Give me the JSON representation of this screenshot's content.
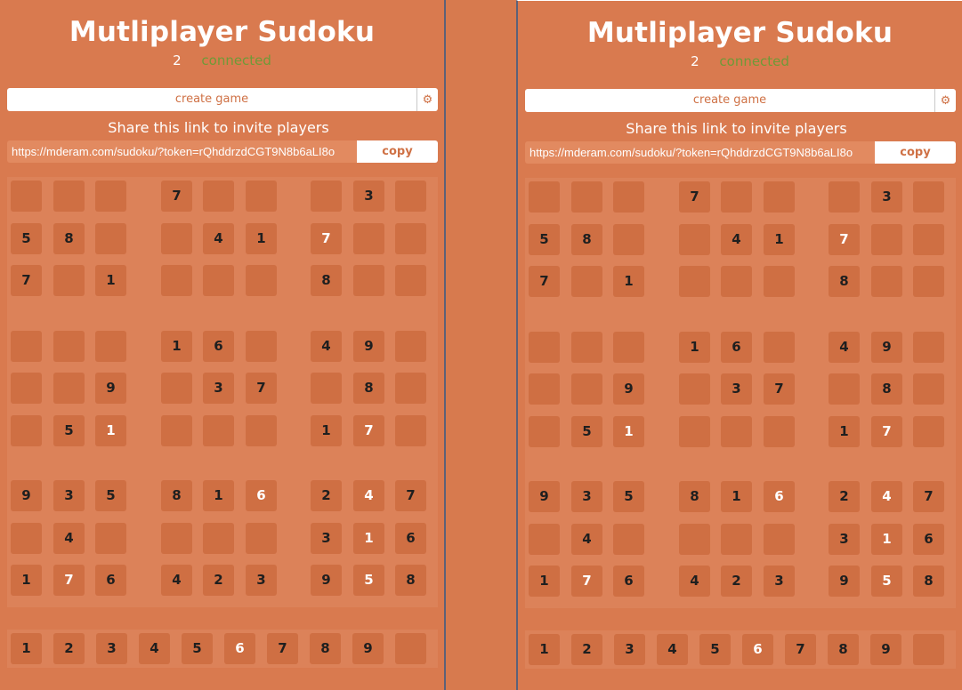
{
  "app": {
    "title": "Mutliplayer Sudoku",
    "connected_count": "2",
    "connected_label": "connected",
    "create_game_label": "create game",
    "settings_icon": "gear-icon",
    "share_label": "Share this link to invite players",
    "share_link": "https://mderam.com/sudoku/?token=rQhddrzdCGT9N8b6aLI8o",
    "copy_label": "copy"
  },
  "colors": {
    "background": "#d97a4f",
    "cell": "#cf6f43",
    "connected": "#6f9a38",
    "divider": "#5c6178"
  },
  "board": [
    [
      "",
      "",
      "",
      "7",
      "",
      "",
      "",
      "3",
      ""
    ],
    [
      "5",
      "8",
      "",
      "",
      "4",
      "1",
      "7",
      "",
      ""
    ],
    [
      "7",
      "",
      "1",
      "",
      "",
      "",
      "8",
      "",
      ""
    ],
    [
      "",
      "",
      "",
      "1",
      "6",
      "",
      "4",
      "9",
      ""
    ],
    [
      "",
      "",
      "9",
      "",
      "3",
      "7",
      "",
      "8",
      ""
    ],
    [
      "",
      "5",
      "1",
      "",
      "",
      "",
      "1",
      "7",
      ""
    ],
    [
      "9",
      "3",
      "5",
      "8",
      "1",
      "6",
      "2",
      "4",
      "7"
    ],
    [
      "",
      "4",
      "",
      "",
      "",
      "",
      "3",
      "1",
      "6"
    ],
    [
      "1",
      "7",
      "6",
      "4",
      "2",
      "3",
      "9",
      "5",
      "8"
    ]
  ],
  "white_cells": [
    [
      1,
      6
    ],
    [
      5,
      2
    ],
    [
      5,
      7
    ],
    [
      6,
      5
    ],
    [
      6,
      7
    ],
    [
      7,
      7
    ],
    [
      8,
      1
    ],
    [
      8,
      7
    ]
  ],
  "keypad": [
    "1",
    "2",
    "3",
    "4",
    "5",
    "6",
    "7",
    "8",
    "9",
    ""
  ],
  "keypad_white": [
    5
  ]
}
